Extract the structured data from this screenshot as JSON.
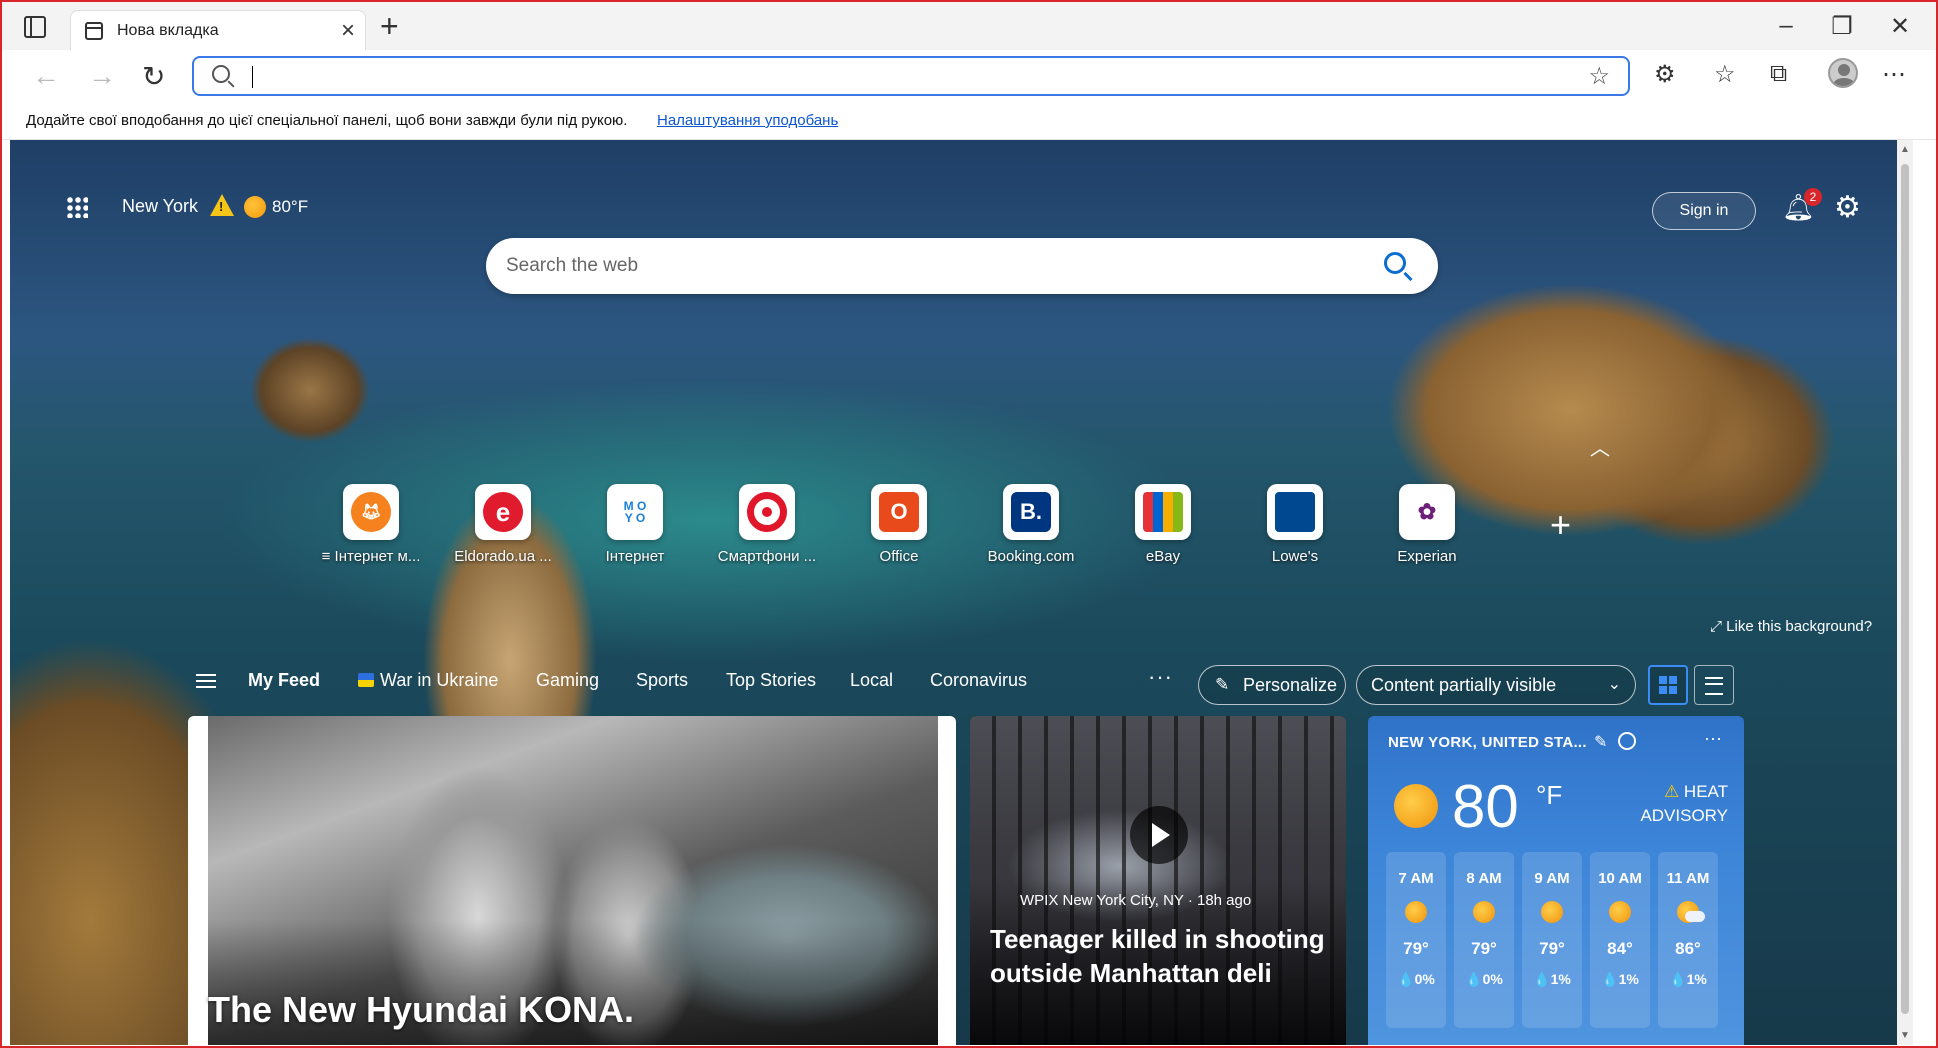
{
  "tab": {
    "title": "Нова вкладка"
  },
  "favorites_bar": {
    "hint": "Додайте свої вподобання до цієї спеціальної панелі, щоб вони завжди були під рукою.",
    "link": "Налаштування уподобань"
  },
  "header": {
    "location": "New York",
    "temperature": "80°F",
    "sign_in": "Sign in",
    "notification_count": "2"
  },
  "search": {
    "placeholder": "Search the web"
  },
  "quick_links": [
    {
      "label": "≡ Інтернет м...",
      "icon": "fox-icon",
      "color": "#f5821f"
    },
    {
      "label": "Eldorado.ua ...",
      "icon": "eldorado-icon",
      "color": "#e01b2d"
    },
    {
      "label": "Інтернет",
      "icon": "moyo-icon",
      "color": "#1a7fd4"
    },
    {
      "label": "Смартфони ...",
      "icon": "target-icon",
      "color": "#e0162b"
    },
    {
      "label": "Office",
      "icon": "office-icon",
      "color": "#e84a1c"
    },
    {
      "label": "Booking.com",
      "icon": "booking-icon",
      "color": "#003580"
    },
    {
      "label": "eBay",
      "icon": "ebay-icon",
      "color": "#e53238"
    },
    {
      "label": "Lowe's",
      "icon": "lowes-icon",
      "color": "#004990"
    },
    {
      "label": "Experian",
      "icon": "experian-icon",
      "color": "#6d2077"
    }
  ],
  "background_prompt": "Like this background?",
  "feed_nav": {
    "items": [
      "My Feed",
      "War in Ukraine",
      "Gaming",
      "Sports",
      "Top Stories",
      "Local",
      "Coronavirus"
    ],
    "personalize": "Personalize",
    "content_visibility": "Content partially visible"
  },
  "cards": {
    "ad_title": "The New Hyundai KONA.",
    "news_source": "WPIX New York City, NY · 18h ago",
    "news_title": "Teenager killed in shooting outside Manhattan deli"
  },
  "weather": {
    "location": "NEW YORK, UNITED STA...",
    "temperature": "80",
    "unit": "°F",
    "alert_line1": "HEAT",
    "alert_line2": "ADVISORY",
    "hourly": [
      {
        "time": "7 AM",
        "temp": "79°",
        "precip": "💧0%",
        "icon": "sun-icon"
      },
      {
        "time": "8 AM",
        "temp": "79°",
        "precip": "💧0%",
        "icon": "sun-icon"
      },
      {
        "time": "9 AM",
        "temp": "79°",
        "precip": "💧1%",
        "icon": "sun-icon"
      },
      {
        "time": "10 AM",
        "temp": "84°",
        "precip": "💧1%",
        "icon": "sun-icon"
      },
      {
        "time": "11 AM",
        "temp": "86°",
        "precip": "💧1%",
        "icon": "partly-cloudy-icon"
      }
    ]
  }
}
